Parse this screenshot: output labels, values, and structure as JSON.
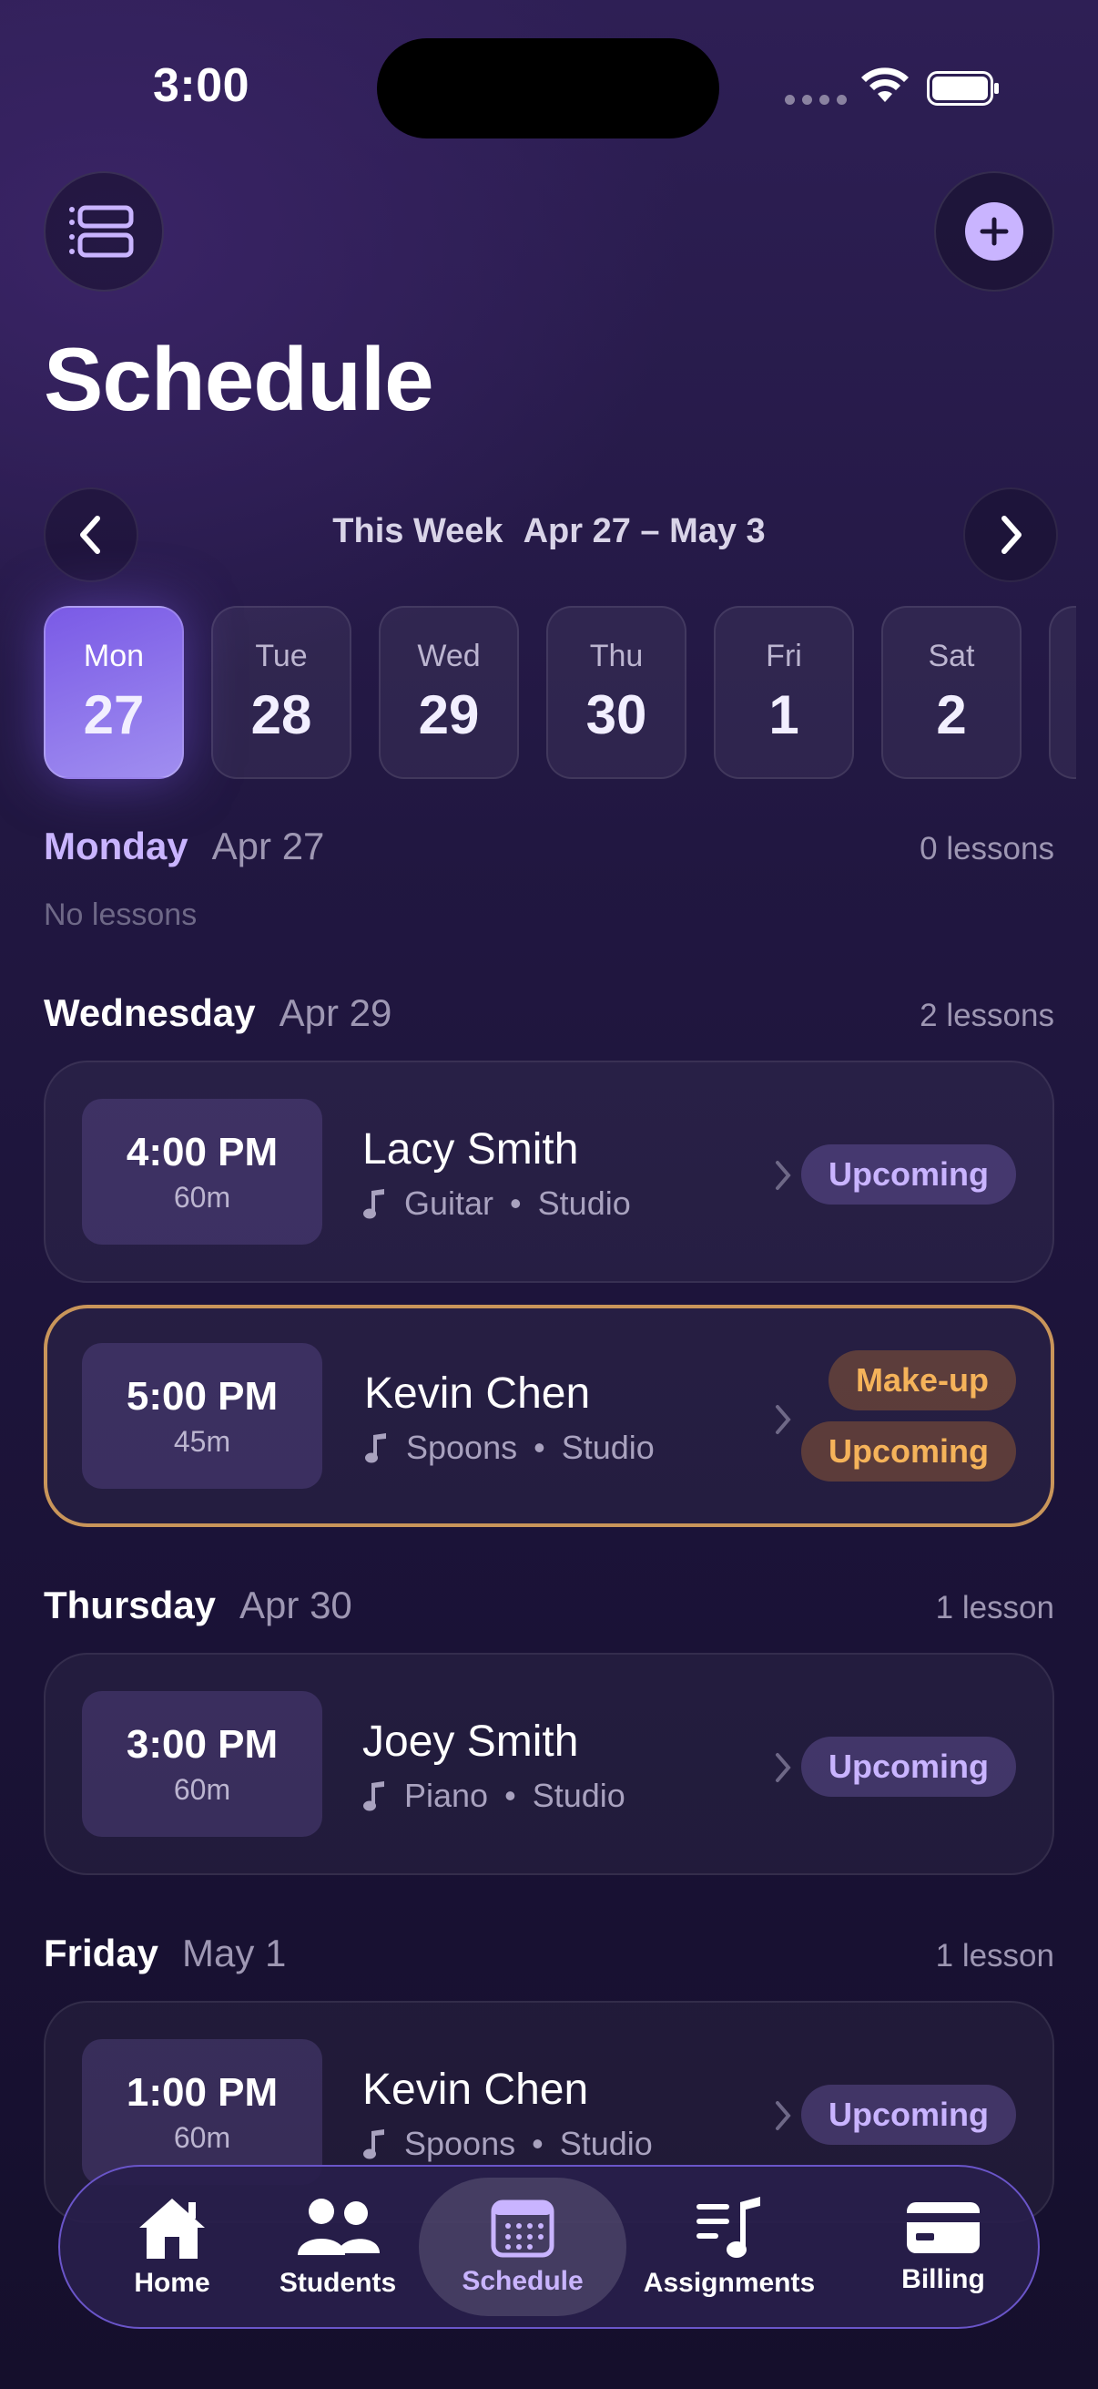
{
  "status": {
    "time": "3:00"
  },
  "page": {
    "title": "Schedule"
  },
  "week": {
    "label": "This Week",
    "range": "Apr 27 – May 3"
  },
  "days": [
    {
      "name": "Mon",
      "num": "27",
      "active": true
    },
    {
      "name": "Tue",
      "num": "28"
    },
    {
      "name": "Wed",
      "num": "29"
    },
    {
      "name": "Thu",
      "num": "30"
    },
    {
      "name": "Fri",
      "num": "1"
    },
    {
      "name": "Sat",
      "num": "2"
    }
  ],
  "sections": {
    "monday": {
      "day": "Monday",
      "date": "Apr 27",
      "count": "0 lessons",
      "empty": "No lessons"
    },
    "wednesday": {
      "day": "Wednesday",
      "date": "Apr 29",
      "count": "2 lessons"
    },
    "thursday": {
      "day": "Thursday",
      "date": "Apr 30",
      "count": "1 lesson"
    },
    "friday": {
      "day": "Friday",
      "date": "May 1",
      "count": "1 lesson"
    }
  },
  "lessons": [
    {
      "time": "4:00 PM",
      "duration": "60m",
      "student": "Lacy Smith",
      "instrument": "Guitar",
      "location": "Studio",
      "status": "Upcoming"
    },
    {
      "time": "5:00 PM",
      "duration": "45m",
      "student": "Kevin Chen",
      "instrument": "Spoons",
      "location": "Studio",
      "tag": "Make-up",
      "status": "Upcoming"
    },
    {
      "time": "3:00 PM",
      "duration": "60m",
      "student": "Joey Smith",
      "instrument": "Piano",
      "location": "Studio",
      "status": "Upcoming"
    },
    {
      "time": "1:00 PM",
      "duration": "60m",
      "student": "Kevin Chen",
      "instrument": "Spoons",
      "location": "Studio",
      "status": "Upcoming"
    }
  ],
  "tabs": [
    {
      "label": "Home",
      "icon": "home-icon"
    },
    {
      "label": "Students",
      "icon": "students-icon"
    },
    {
      "label": "Schedule",
      "icon": "calendar-icon",
      "active": true
    },
    {
      "label": "Assignments",
      "icon": "assignments-icon"
    },
    {
      "label": "Billing",
      "icon": "card-icon"
    }
  ],
  "colors": {
    "accent": "#c9b4ff",
    "makeup": "#f5b35a",
    "active_day": "#7a5ae6"
  }
}
